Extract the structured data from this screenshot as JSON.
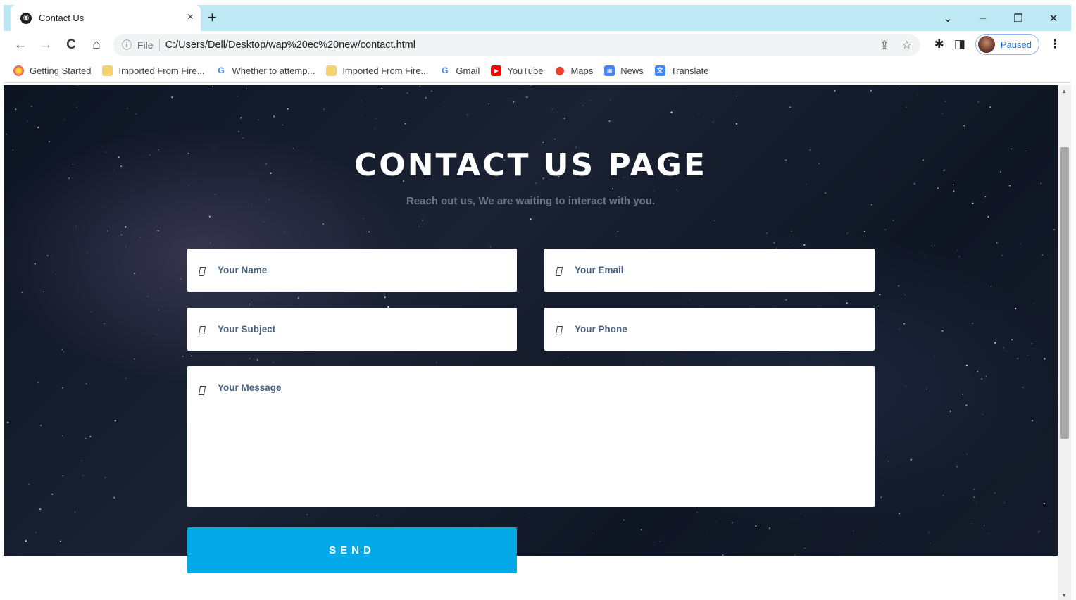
{
  "browser": {
    "tab": {
      "title": "Contact Us",
      "favicon": "globe-icon",
      "close": "×"
    },
    "new_tab": "+",
    "window_controls": {
      "dropdown": "⌄",
      "minimize": "–",
      "restore": "❐",
      "close": "✕"
    },
    "nav": {
      "back": "←",
      "forward": "→",
      "reload": "C",
      "home": "⌂"
    },
    "address": {
      "info_icon": "ⓘ",
      "scheme": "File",
      "url": "C:/Users/Dell/Desktop/wap%20ec%20new/contact.html",
      "share_icon": "⇪",
      "star_icon": "☆"
    },
    "toolbar_icons": {
      "extensions": "✱",
      "side_panel": "◨",
      "menu": "⋮"
    },
    "profile": {
      "status": "Paused"
    },
    "bookmarks": [
      {
        "label": "Getting Started",
        "icon": "firefox-icon"
      },
      {
        "label": "Imported From Fire...",
        "icon": "folder-icon"
      },
      {
        "label": "Whether to attemp...",
        "icon": "google-icon"
      },
      {
        "label": "Imported From Fire...",
        "icon": "folder-icon"
      },
      {
        "label": "Gmail",
        "icon": "google-icon"
      },
      {
        "label": "YouTube",
        "icon": "youtube-icon"
      },
      {
        "label": "Maps",
        "icon": "maps-icon"
      },
      {
        "label": "News",
        "icon": "news-icon"
      },
      {
        "label": "Translate",
        "icon": "translate-icon"
      }
    ]
  },
  "page": {
    "title": "CONTACT US PAGE",
    "subtitle": "Reach out us, We are waiting to interact with you.",
    "form": {
      "name_placeholder": "Your Name",
      "email_placeholder": "Your Email",
      "subject_placeholder": "Your Subject",
      "phone_placeholder": "Your Phone",
      "message_placeholder": "Your Message",
      "send_label": "SEND"
    }
  }
}
